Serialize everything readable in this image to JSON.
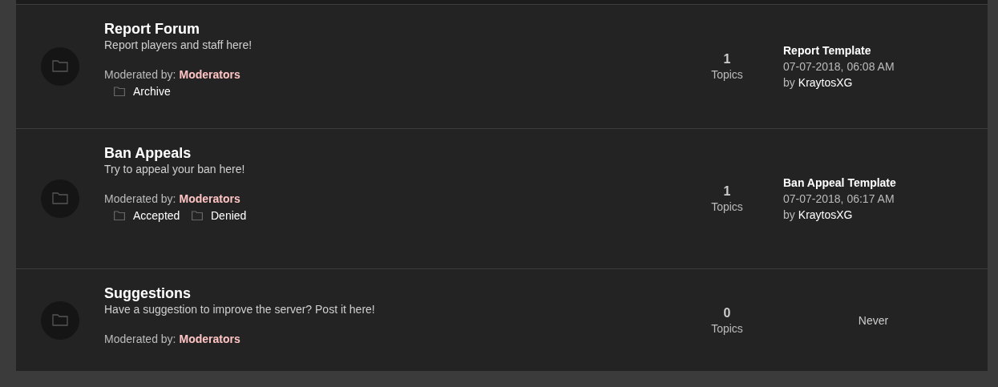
{
  "forums": [
    {
      "title": "Report Forum",
      "description": "Report players and staff here!",
      "moderated_label": "Moderated by:",
      "moderators": "Moderators",
      "subforums": [
        {
          "name": "Archive"
        }
      ],
      "stats": {
        "count": "1",
        "label": "Topics"
      },
      "last_post": {
        "kind": "post",
        "title": "Report Template",
        "date": "07-07-2018, 06:08 AM",
        "by_label": "by",
        "author": "KraytosXG"
      }
    },
    {
      "title": "Ban Appeals",
      "description": "Try to appeal your ban here!",
      "moderated_label": "Moderated by:",
      "moderators": "Moderators",
      "subforums": [
        {
          "name": "Accepted"
        },
        {
          "name": "Denied"
        }
      ],
      "stats": {
        "count": "1",
        "label": "Topics"
      },
      "last_post": {
        "kind": "post",
        "title": "Ban Appeal Template",
        "date": "07-07-2018, 06:17 AM",
        "by_label": "by",
        "author": "KraytosXG"
      }
    },
    {
      "title": "Suggestions",
      "description": "Have a suggestion to improve the server? Post it here!",
      "moderated_label": "Moderated by:",
      "moderators": "Moderators",
      "stats": {
        "count": "0",
        "label": "Topics"
      },
      "last_post": {
        "kind": "never",
        "text": "Never"
      }
    }
  ]
}
